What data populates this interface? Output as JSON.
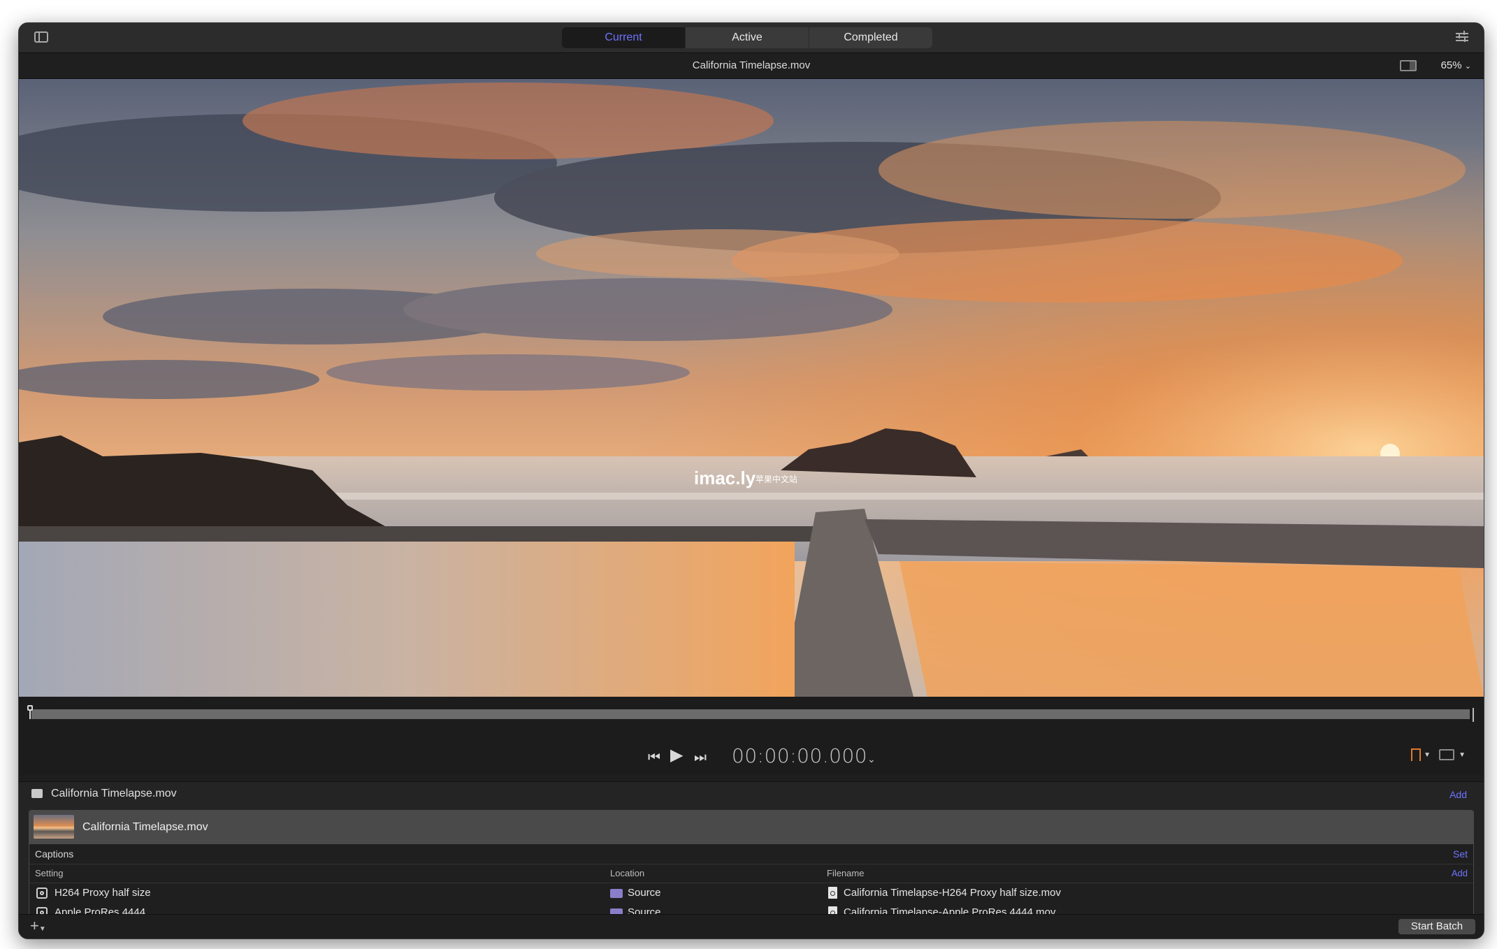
{
  "toolbar": {
    "tabs": [
      {
        "label": "Current",
        "selected": true
      },
      {
        "label": "Active",
        "selected": false
      },
      {
        "label": "Completed",
        "selected": false
      }
    ],
    "accent_color": "#6f73ff"
  },
  "viewer": {
    "filename": "California Timelapse.mov",
    "zoom": "65%",
    "watermark_main": "imac.ly",
    "watermark_sub": "苹果中文站"
  },
  "transport": {
    "timecode": "00:00:00.000"
  },
  "batch": {
    "source_label": "California Timelapse.mov",
    "add_label": "Add",
    "job": {
      "name": "California Timelapse.mov",
      "captions_label": "Captions",
      "captions_action": "Set",
      "columns": {
        "setting": "Setting",
        "location": "Location",
        "filename": "Filename",
        "add": "Add"
      },
      "outputs": [
        {
          "setting": "H264 Proxy half size",
          "location": "Source",
          "filename": "California Timelapse-H264 Proxy half size.mov"
        },
        {
          "setting": "Apple ProRes 4444",
          "location": "Source",
          "filename": "California Timelapse-Apple ProRes 4444.mov"
        }
      ]
    }
  },
  "footer": {
    "start_button": "Start Batch"
  }
}
